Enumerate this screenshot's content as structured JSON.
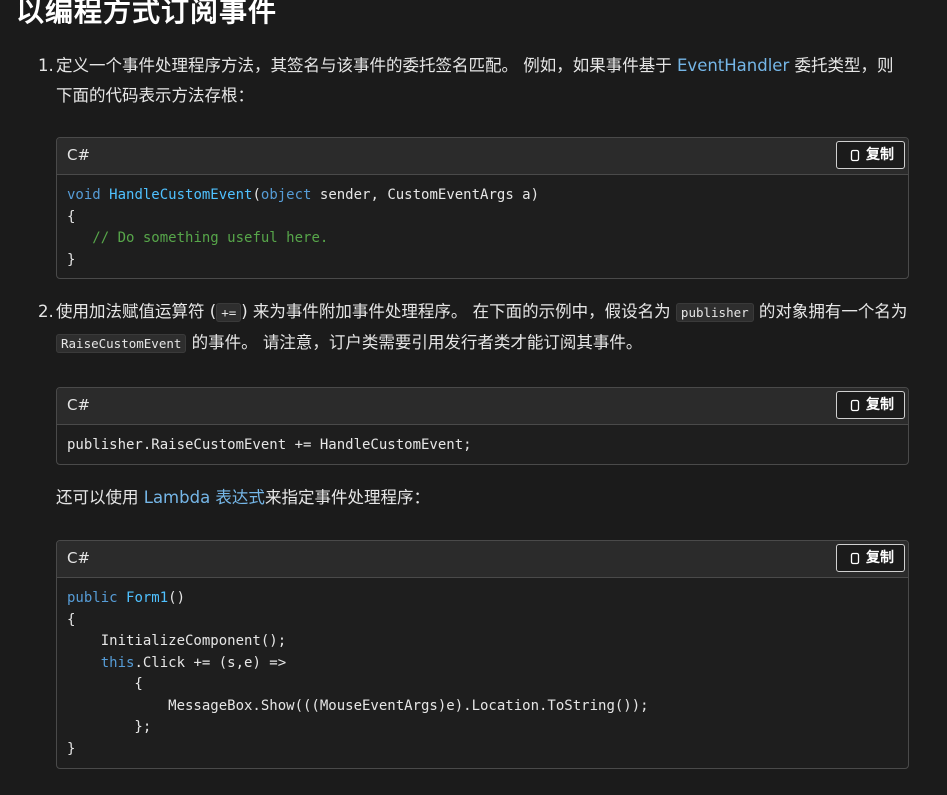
{
  "title": "以编程方式订阅事件",
  "step1": {
    "number": "1.",
    "text_a": "定义一个事件处理程序方法，其签名与该事件的委托签名匹配。 例如，如果事件基于 ",
    "link": "EventHandler",
    "text_b": " 委托类型，则下面的代码表示方法存根："
  },
  "code1": {
    "lang": "C#",
    "copy_label": "复制",
    "l1_kw": "void",
    "l1_fn": "HandleCustomEvent",
    "l1_p": "(",
    "l1_kw2": "object",
    "l1_rest": " sender, CustomEventArgs a)",
    "l2": "{",
    "l3_indent": "   ",
    "l3_comment": "// Do something useful here.",
    "l4": "}"
  },
  "step2": {
    "number": "2.",
    "text_a": "使用加法赋值运算符 (",
    "op": "+=",
    "text_b": ") 来为事件附加事件处理程序。 在下面的示例中，假设名为 ",
    "code_a": "publisher",
    "text_c": " 的对象拥有一个名为 ",
    "code_b": "RaiseCustomEvent",
    "text_d": " 的事件。 请注意，订户类需要引用发行者类才能订阅其事件。"
  },
  "code2": {
    "lang": "C#",
    "copy_label": "复制",
    "l1": "publisher.RaiseCustomEvent += HandleCustomEvent;"
  },
  "lambda_para": {
    "text_a": "还可以使用 ",
    "link": "Lambda 表达式",
    "text_b": "来指定事件处理程序："
  },
  "code3": {
    "lang": "C#",
    "copy_label": "复制",
    "l1_kw": "public",
    "l1_fn": "Form1",
    "l1_rest": "()",
    "l2": "{",
    "l3": "    InitializeComponent();",
    "l4_indent": "    ",
    "l4_kw": "this",
    "l4_rest": ".Click += (s,e) =>",
    "l5": "        {",
    "l6": "            MessageBox.Show(((MouseEventArgs)e).Location.ToString());",
    "l7": "        };",
    "l8": "}"
  }
}
